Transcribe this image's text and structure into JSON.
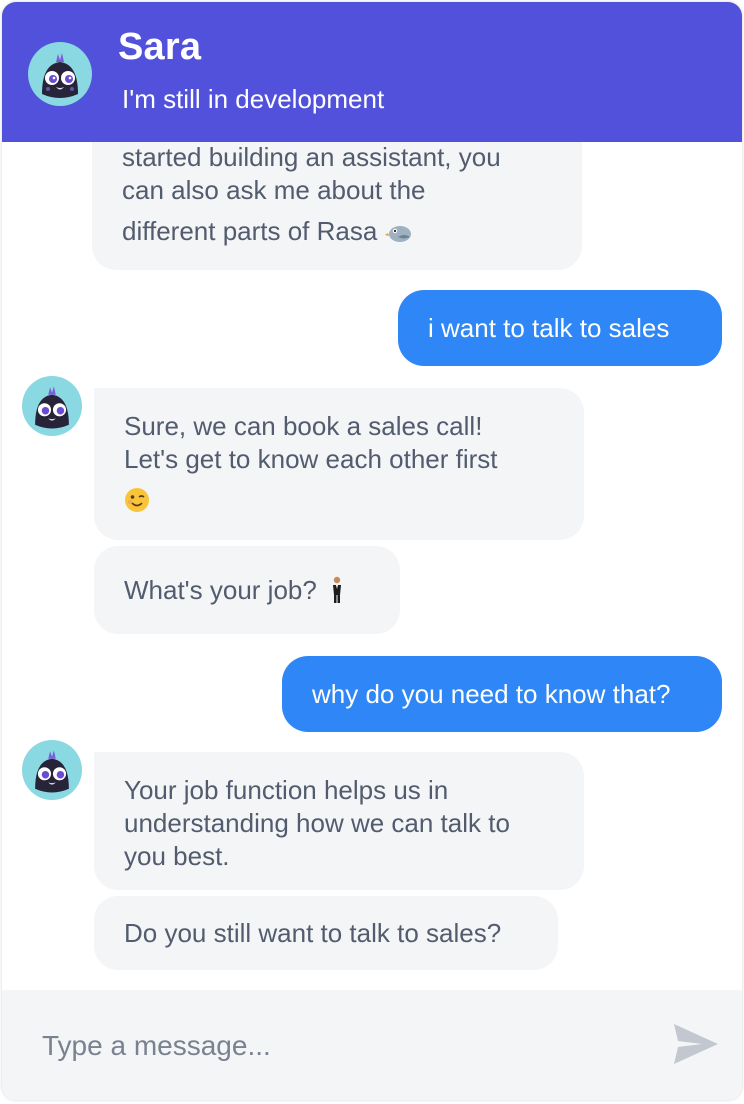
{
  "header": {
    "title": "Sara",
    "subtitle": "I'm still in development"
  },
  "messages": [
    {
      "sender": "bot",
      "lines": [
        "started building an assistant, you",
        "can also ask me about the",
        "different parts of Rasa"
      ],
      "emoji": "bird-emoji"
    },
    {
      "sender": "user",
      "text": "i want to talk to sales"
    },
    {
      "sender": "bot",
      "lines": [
        "Sure, we can book a sales call!",
        "Let's get to know each other first"
      ],
      "emoji": "winking-face-emoji"
    },
    {
      "sender": "bot",
      "text": "What's your job?",
      "emoji": "person-in-suit-emoji"
    },
    {
      "sender": "user",
      "text": "why do you need to know that?"
    },
    {
      "sender": "bot",
      "lines": [
        "Your job function helps us in",
        "understanding how we can talk to",
        "you best."
      ]
    },
    {
      "sender": "bot",
      "text": "Do you still want to talk to sales?"
    }
  ],
  "composer": {
    "placeholder": "Type a message...",
    "send_icon": "send-icon"
  },
  "colors": {
    "header": "#5151db",
    "user_bubble": "#2f86f6",
    "bot_bubble": "#f4f5f7",
    "bot_text": "#525c6e"
  }
}
